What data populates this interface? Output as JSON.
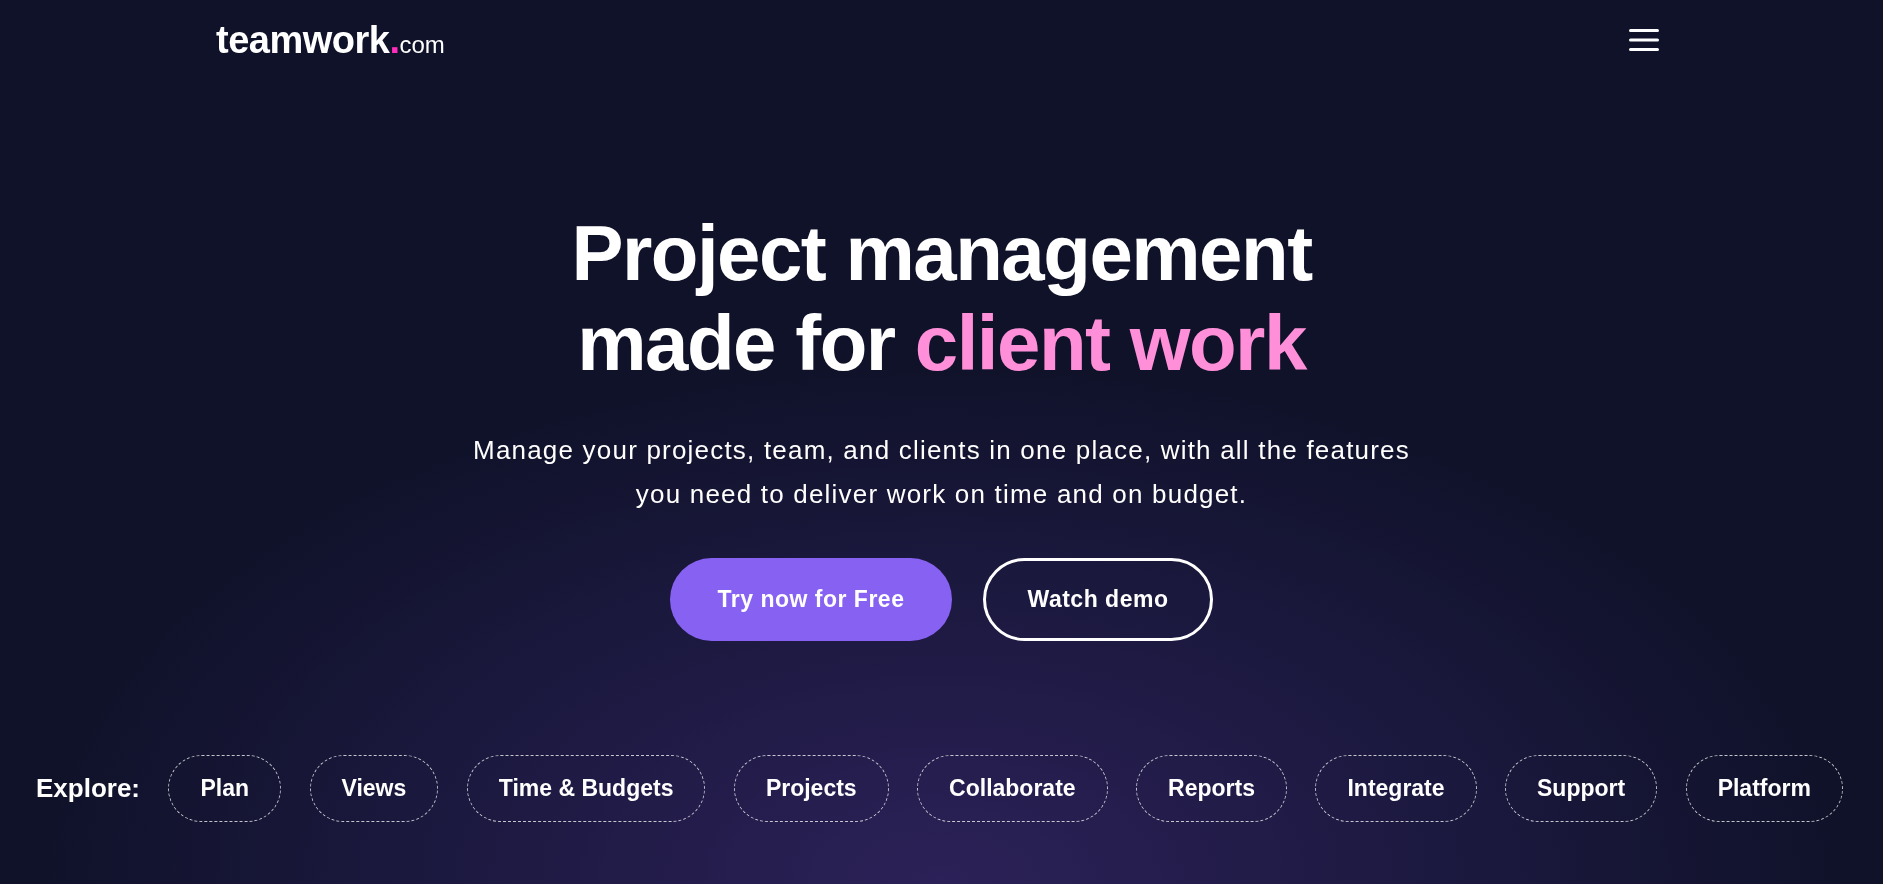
{
  "header": {
    "logo": {
      "word": "teamwork",
      "dot": ".",
      "domain": "com"
    }
  },
  "hero": {
    "headline": {
      "lines": [
        "Project management",
        "made for"
      ],
      "highlight": "client work"
    },
    "subtitle": "Manage your projects, team, and clients in one place, with all the features you need to deliver work on time and on budget.",
    "buttons": [
      {
        "label": "Try now for Free",
        "kind": "primary"
      },
      {
        "label": "Watch demo",
        "kind": "outline"
      }
    ]
  },
  "explore": {
    "label": "Explore:",
    "items": [
      "Plan",
      "Views",
      "Time & Budgets",
      "Projects",
      "Collaborate",
      "Reports",
      "Integrate",
      "Support",
      "Platform"
    ]
  }
}
